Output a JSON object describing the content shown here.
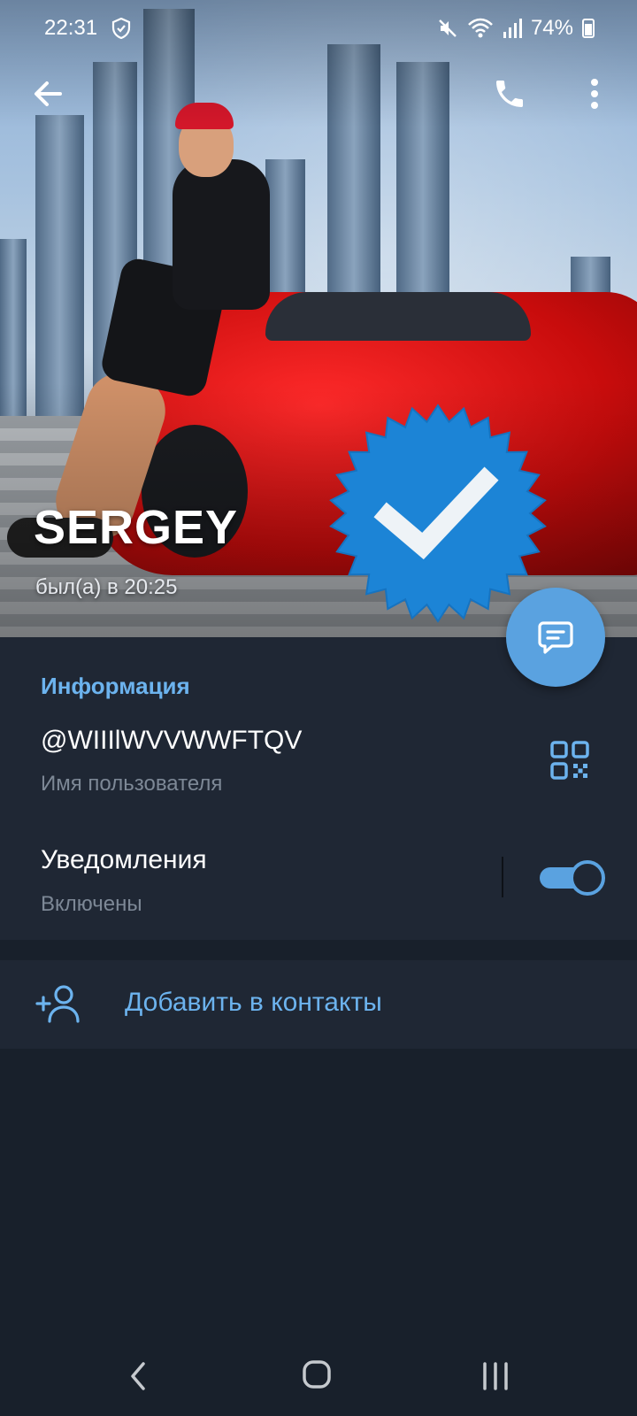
{
  "status_bar": {
    "time": "22:31",
    "battery": "74%"
  },
  "profile": {
    "name": "SERGEY",
    "last_seen": "был(а) в 20:25"
  },
  "info": {
    "section_title": "Информация",
    "username": "@WIIIlWVVWWFTQV",
    "username_label": "Имя пользователя",
    "notifications_title": "Уведомления",
    "notifications_state": "Включены",
    "notifications_enabled": true
  },
  "actions": {
    "add_contact_label": "Добавить в контакты"
  },
  "colors": {
    "accent": "#6cb3ee",
    "fab": "#5aa2e0",
    "card_bg": "#1f2734",
    "screen_bg": "#18202b",
    "badge": "#1c84d6"
  },
  "icons": {
    "back": "arrow-left-icon",
    "call": "phone-icon",
    "more": "more-vertical-icon",
    "fab": "message-icon",
    "qr": "qr-code-icon",
    "add_contact": "add-user-icon",
    "verified": "verified-badge-icon"
  }
}
